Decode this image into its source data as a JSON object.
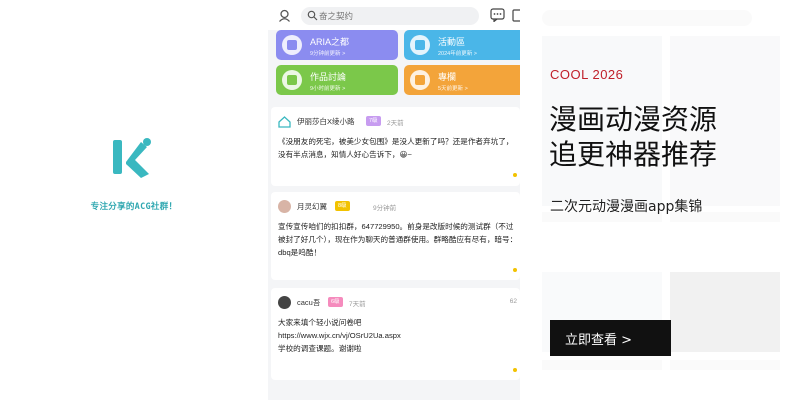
{
  "splash": {
    "tagline": "专注分享的ACG社群！",
    "accent": "#2fa7b0"
  },
  "phone": {
    "search": {
      "placeholder": "奋之契约"
    },
    "tiles": [
      {
        "title": "ARIA之都",
        "subtitle": "9分钟前更新 >",
        "color": "#8b8cf0"
      },
      {
        "title": "活動區",
        "subtitle": "2024年前更新 >",
        "color": "#4ab6e8"
      },
      {
        "title": "作品討論",
        "subtitle": "9小时前更新 >",
        "color": "#7bc84a"
      },
      {
        "title": "專欄",
        "subtitle": "5天前更新 >",
        "color": "#f3a43a"
      }
    ],
    "posts": [
      {
        "user": "伊丽莎白X绫小路",
        "tag": "7级",
        "time": "2天前",
        "body": "《没朋友的死宅，被美少女包围》是没人更新了吗？还是作者弃坑了，没有半点消息，知情人好心告诉下，😀~"
      },
      {
        "user": "月灵幻翼",
        "tag": "8级",
        "time": "9分钟前",
        "body": "宣传宣传咱们的扣扣群，647729950。前身是改版时候的测试群（不过被封了好几个），现在作为聊天的普通群使用。群略酷应有尽有，暗号：dbq是呜酷！"
      },
      {
        "user": "cacu吾",
        "tag": "6级",
        "time": "7天前",
        "num": "62",
        "body": "大家来填个轻小说问卷吧\nhttps://www.wjx.cn/vj/OSrU2Ua.aspx\n学校的调查课题。谢谢啦"
      }
    ]
  },
  "promo": {
    "brand": "COOL 2026",
    "title_line1": "漫画动漫资源",
    "title_line2": "追更神器推荐",
    "subtitle": "二次元动漫漫画app集锦",
    "cta": "立即查看 >",
    "brand_color": "#c0202a"
  }
}
